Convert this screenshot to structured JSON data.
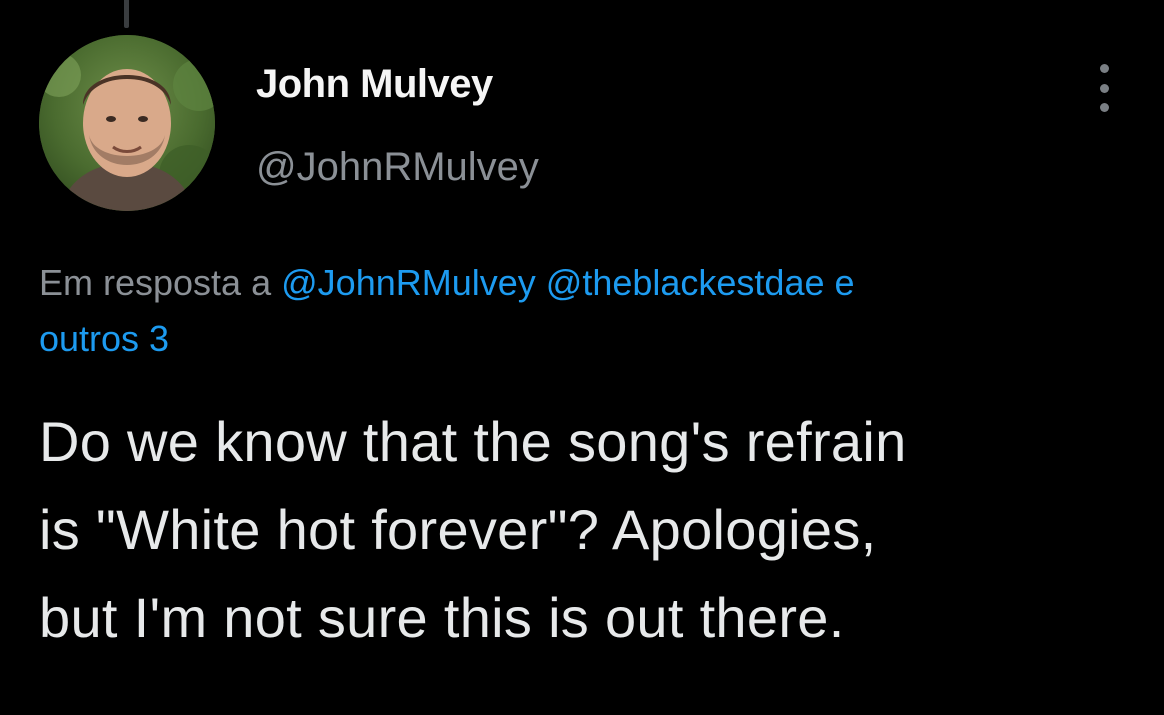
{
  "tweet": {
    "author": {
      "name": "John Mulvey",
      "handle": "@JohnRMulvey",
      "avatar_icon": "person-avatar-photo"
    },
    "reply_context": {
      "prefix": "Em resposta a",
      "mentions": [
        "@JohnRMulvey",
        "@theblackestdae"
      ],
      "connector": "e",
      "others": "outros 3"
    },
    "text_lines": [
      "Do we know that the song's refrain",
      "is \"White hot forever\"? Apologies,",
      "but I'm not sure this is out there."
    ],
    "more_icon": "vertical-ellipsis-icon"
  },
  "colors": {
    "background": "#000000",
    "text": "#e7e9ea",
    "secondary": "#8b9096",
    "link": "#1d9bf0"
  }
}
